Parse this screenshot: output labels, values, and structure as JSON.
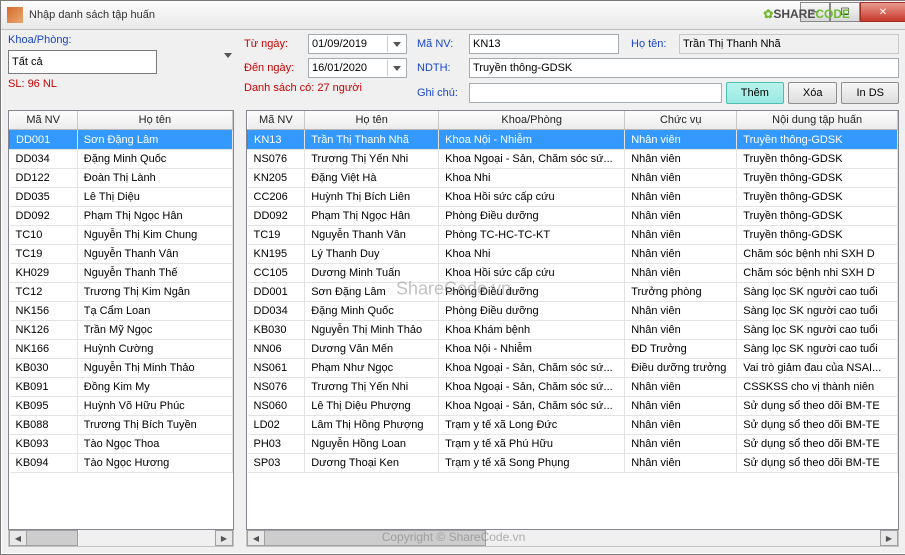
{
  "window": {
    "title": "Nhập danh sách tập huấn"
  },
  "left": {
    "khoaPhongLabel": "Khoa/Phòng:",
    "khoaPhongValue": "Tất cả",
    "slLabel": "SL: 96 NL"
  },
  "dates": {
    "fromLabel": "Từ ngày:",
    "fromValue": "01/09/2019",
    "toLabel": "Đến ngày:",
    "toValue": "16/01/2020"
  },
  "form": {
    "maNVLabel": "Mã NV:",
    "maNVValue": "KN13",
    "hoTenLabel": "Họ tên:",
    "hoTenValue": "Trần Thị Thanh Nhã",
    "ndthLabel": "NDTH:",
    "ndthValue": "Truyền thông-GDSK",
    "ghiChuLabel": "Ghi chú:",
    "ghiChuValue": ""
  },
  "buttons": {
    "them": "Thêm",
    "xoa": "Xóa",
    "inds": "In DS"
  },
  "list1": {
    "countLabel": "Danh sách có: 27 người",
    "headers": [
      "Mã NV",
      "Họ tên"
    ],
    "rows": [
      [
        "DD001",
        "Sơn Đặng Lâm"
      ],
      [
        "DD034",
        "Đặng Minh Quốc"
      ],
      [
        "DD122",
        "Đoàn Thị Lành"
      ],
      [
        "DD035",
        "Lê Thị Diệu"
      ],
      [
        "DD092",
        "Phạm Thị Ngọc Hân"
      ],
      [
        "TC10",
        "Nguyễn Thị Kim Chung"
      ],
      [
        "TC19",
        "Nguyễn Thanh Vân"
      ],
      [
        "KH029",
        "Nguyễn Thanh Thế"
      ],
      [
        "TC12",
        "Trương Thị Kim Ngân"
      ],
      [
        "NK156",
        "Tạ Cẩm Loan"
      ],
      [
        "NK126",
        "Trần Mỹ Ngọc"
      ],
      [
        "NK166",
        "Huỳnh Cường"
      ],
      [
        "KB030",
        "Nguyễn Thị Minh Thảo"
      ],
      [
        "KB091",
        "Đồng Kim My"
      ],
      [
        "KB095",
        "Huỳnh Võ Hữu Phúc"
      ],
      [
        "KB088",
        "Trương Thị Bích Tuyền"
      ],
      [
        "KB093",
        "Tào Ngọc Thoa"
      ],
      [
        "KB094",
        "Tào Ngọc Hương"
      ]
    ]
  },
  "list2": {
    "headers": [
      "Mã NV",
      "Họ tên",
      "Khoa/Phòng",
      "Chức vụ",
      "Nội dung tập huấn"
    ],
    "rows": [
      [
        "KN13",
        "Trần Thị Thanh Nhã",
        "Khoa Nội - Nhiễm",
        "Nhân viên",
        "Truyền thông-GDSK"
      ],
      [
        "NS076",
        "Trương Thị Yến Nhi",
        "Khoa Ngoại - Sản, Chăm sóc sứ...",
        "Nhân viên",
        "Truyền thông-GDSK"
      ],
      [
        "KN205",
        "Đặng Việt Hà",
        "Khoa Nhi",
        "Nhân viên",
        "Truyền thông-GDSK"
      ],
      [
        "CC206",
        "Huỳnh Thị Bích Liên",
        "Khoa Hồi sức cấp cứu",
        "Nhân viên",
        "Truyền thông-GDSK"
      ],
      [
        "DD092",
        "Phạm Thị Ngọc Hân",
        "Phòng Điều dưỡng",
        "Nhân viên",
        "Truyền thông-GDSK"
      ],
      [
        "TC19",
        "Nguyễn Thanh Vân",
        "Phòng TC-HC-TC-KT",
        "Nhân viên",
        "Truyền thông-GDSK"
      ],
      [
        "KN195",
        "Lý Thanh Duy",
        "Khoa Nhi",
        "Nhân viên",
        "Chăm sóc bệnh nhi SXH D"
      ],
      [
        "CC105",
        "Dương Minh Tuấn",
        "Khoa Hồi sức cấp cứu",
        "Nhân viên",
        "Chăm sóc bệnh nhi SXH D"
      ],
      [
        "DD001",
        "Sơn Đặng Lâm",
        "Phòng Điều dưỡng",
        "Trưởng phòng",
        "Sàng lọc SK người cao tuổi"
      ],
      [
        "DD034",
        "Đặng Minh Quốc",
        "Phòng Điều dưỡng",
        "Nhân viên",
        "Sàng lọc SK người cao tuổi"
      ],
      [
        "KB030",
        "Nguyễn Thị Minh Thảo",
        "Khoa Khám bệnh",
        "Nhân viên",
        "Sàng lọc SK người cao tuổi"
      ],
      [
        "NN06",
        "Dương Văn Mến",
        "Khoa Nội - Nhiễm",
        "ĐD Trưởng",
        "Sàng lọc SK người cao tuổi"
      ],
      [
        "NS061",
        "Phạm Như Ngọc",
        "Khoa Ngoại - Sản, Chăm sóc sứ...",
        "Điều dưỡng trưởng",
        "Vai trò giảm đau của NSAI..."
      ],
      [
        "NS076",
        "Trương Thị Yến Nhi",
        "Khoa Ngoại - Sản, Chăm sóc sứ...",
        "Nhân viên",
        "CSSKSS cho vị thành niên"
      ],
      [
        "NS060",
        "Lê Thị Diệu Phượng",
        "Khoa Ngoại - Sản, Chăm sóc sứ...",
        "Nhân viên",
        "Sử dụng sổ theo dõi BM-TE"
      ],
      [
        "LD02",
        "Lâm Thị Hồng Phượng",
        "Trạm y tế xã Long Đức",
        "Nhân viên",
        "Sử dụng sổ theo dõi BM-TE"
      ],
      [
        "PH03",
        "Nguyễn Hồng Loan",
        "Trạm y tế xã Phú Hữu",
        "Nhân viên",
        "Sử dụng sổ theo dõi BM-TE"
      ],
      [
        "SP03",
        "Dương Thoại Ken",
        "Trạm y tế xã Song Phụng",
        "Nhân viên",
        "Sử dụng sổ theo dõi BM-TE"
      ]
    ]
  },
  "watermark": {
    "mid": "ShareCode.vn",
    "bottom": "Copyright © ShareCode.vn",
    "logo1": "SHARE",
    "logo2": "CODE",
    ".vn": ".vn"
  }
}
